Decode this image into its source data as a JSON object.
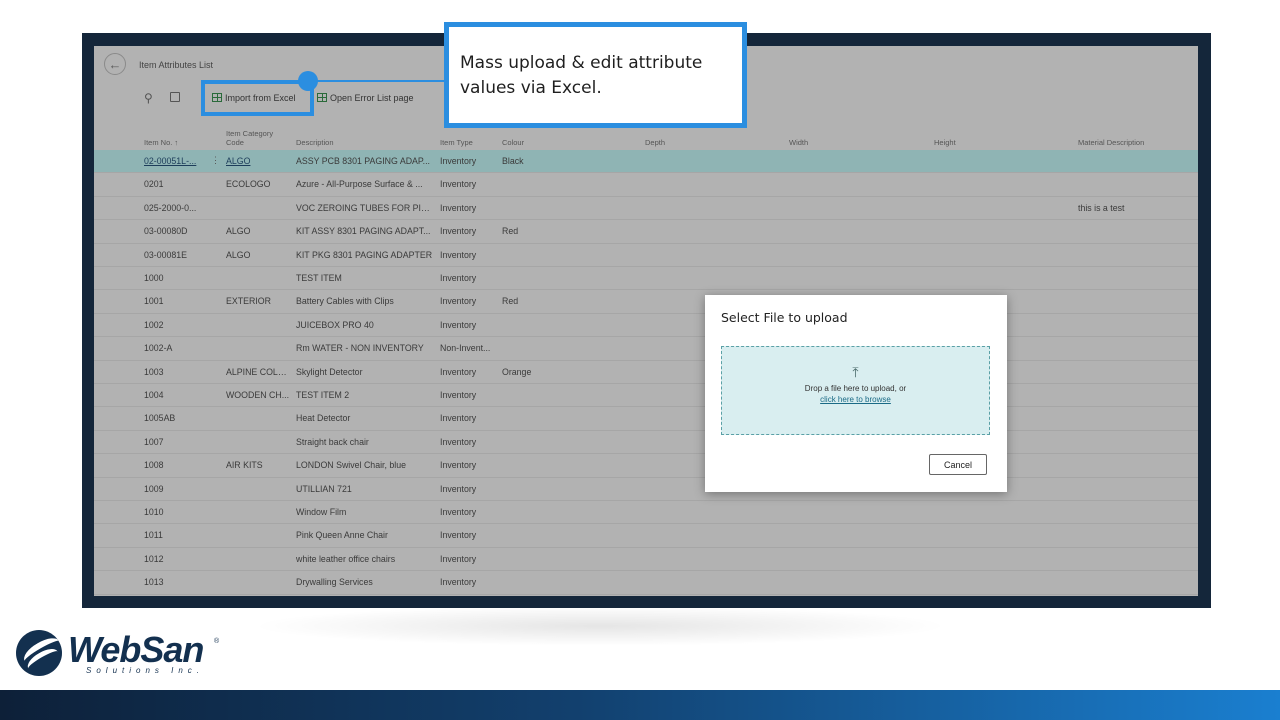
{
  "app": {
    "page_title": "Item Attributes List",
    "back_icon": "back-arrow-icon",
    "toolbar": {
      "import_label": "Import from Excel",
      "error_label": "Open Error List page"
    }
  },
  "callout": {
    "text": "Mass upload & edit attribute values via Excel."
  },
  "table": {
    "headers": {
      "item_no": "Item No. ↑",
      "category": "Item Category Code",
      "description": "Description",
      "item_type": "Item Type",
      "colour": "Colour",
      "depth": "Depth",
      "width": "Width",
      "height": "Height",
      "material": "Material Description"
    },
    "rows": [
      {
        "item_no": "02-00051L-...",
        "category": "ALGO",
        "description": "ASSY PCB 8301 PAGING ADAP...",
        "item_type": "Inventory",
        "colour": "Black",
        "material": ""
      },
      {
        "item_no": "0201",
        "category": "ECOLOGO",
        "description": "Azure - All-Purpose Surface & ...",
        "item_type": "Inventory",
        "colour": "",
        "material": ""
      },
      {
        "item_no": "025-2000-0...",
        "category": "",
        "description": "VOC ZEROING TUBES FOR PID,...",
        "item_type": "Inventory",
        "colour": "",
        "material": "this is a test"
      },
      {
        "item_no": "03-00080D",
        "category": "ALGO",
        "description": "KIT ASSY 8301 PAGING ADAPT...",
        "item_type": "Inventory",
        "colour": "Red",
        "material": ""
      },
      {
        "item_no": "03-00081E",
        "category": "ALGO",
        "description": "KIT PKG 8301 PAGING ADAPTER",
        "item_type": "Inventory",
        "colour": "",
        "material": ""
      },
      {
        "item_no": "1000",
        "category": "",
        "description": "TEST ITEM",
        "item_type": "Inventory",
        "colour": "",
        "material": ""
      },
      {
        "item_no": "1001",
        "category": "EXTERIOR",
        "description": "Battery Cables with Clips",
        "item_type": "Inventory",
        "colour": "Red",
        "material": ""
      },
      {
        "item_no": "1002",
        "category": "",
        "description": "JUICEBOX PRO 40",
        "item_type": "Inventory",
        "colour": "",
        "material": ""
      },
      {
        "item_no": "1002-A",
        "category": "",
        "description": "Rm WATER - NON INVENTORY",
        "item_type": "Non-Invent...",
        "colour": "",
        "material": ""
      },
      {
        "item_no": "1003",
        "category": "ALPINE COLL...",
        "description": "Skylight Detector",
        "item_type": "Inventory",
        "colour": "Orange",
        "material": ""
      },
      {
        "item_no": "1004",
        "category": "WOODEN CH...",
        "description": "TEST ITEM 2",
        "item_type": "Inventory",
        "colour": "",
        "material": ""
      },
      {
        "item_no": "1005AB",
        "category": "",
        "description": "Heat Detector",
        "item_type": "Inventory",
        "colour": "",
        "material": ""
      },
      {
        "item_no": "1007",
        "category": "",
        "description": "Straight back chair",
        "item_type": "Inventory",
        "colour": "",
        "material": ""
      },
      {
        "item_no": "1008",
        "category": "AIR KITS",
        "description": "LONDON Swivel Chair, blue",
        "item_type": "Inventory",
        "colour": "",
        "material": ""
      },
      {
        "item_no": "1009",
        "category": "",
        "description": "UTILLIAN 721",
        "item_type": "Inventory",
        "colour": "",
        "material": ""
      },
      {
        "item_no": "1010",
        "category": "",
        "description": "Window Film",
        "item_type": "Inventory",
        "colour": "",
        "material": ""
      },
      {
        "item_no": "1011",
        "category": "",
        "description": "Pink Queen Anne Chair",
        "item_type": "Inventory",
        "colour": "",
        "material": ""
      },
      {
        "item_no": "1012",
        "category": "",
        "description": "white leather office chairs",
        "item_type": "Inventory",
        "colour": "",
        "material": ""
      },
      {
        "item_no": "1013",
        "category": "",
        "description": "Drywalling Services",
        "item_type": "Inventory",
        "colour": "",
        "material": ""
      }
    ],
    "selected_row": 0
  },
  "dialog": {
    "title": "Select File to upload",
    "drop_text": "Drop a file here to upload, or",
    "browse_link": "click here to browse",
    "cancel_label": "Cancel",
    "upload_icon": "upload-arrow-icon"
  },
  "brand": {
    "name": "WebSan",
    "registered": "®",
    "tagline": "Solutions Inc.",
    "accent_color": "#2b8ee0",
    "frame_color": "#14263a"
  }
}
